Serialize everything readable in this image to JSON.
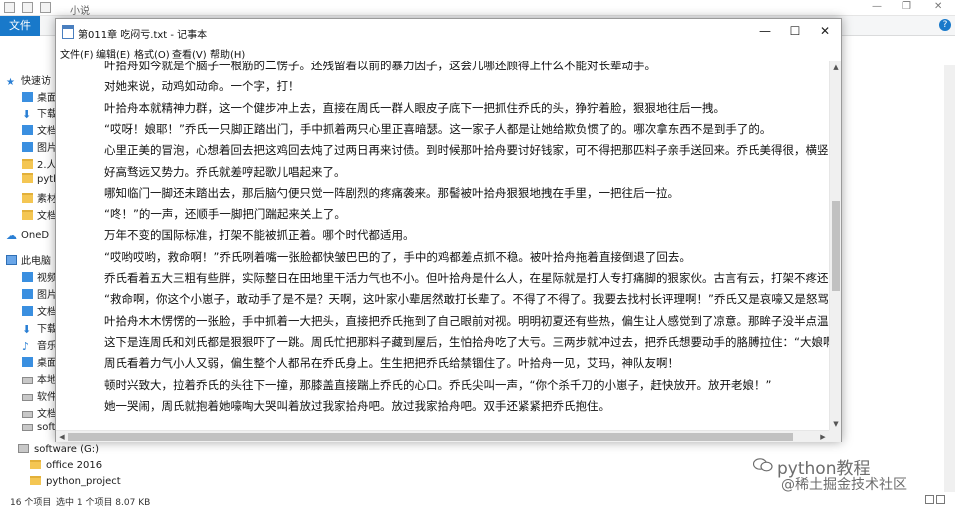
{
  "explorer": {
    "title": "小说",
    "file_tab": "文件",
    "status_items": "16 个项目",
    "status_selection": "选中 1 个项目 8.07 KB",
    "nav_items": [
      {
        "label": "快速访",
        "icon": "star-icon",
        "indent": 0
      },
      {
        "label": "桌面",
        "icon": "desktop-icon",
        "indent": 1
      },
      {
        "label": "下载",
        "icon": "download-icon",
        "indent": 1
      },
      {
        "label": "文档",
        "icon": "document-icon",
        "indent": 1
      },
      {
        "label": "图片",
        "icon": "picture-icon",
        "indent": 1
      },
      {
        "label": "2.人",
        "icon": "folder-icon",
        "indent": 1
      },
      {
        "label": "pyth",
        "icon": "folder-icon",
        "indent": 1
      },
      {
        "label": "素材",
        "icon": "folder-icon",
        "indent": 1
      },
      {
        "label": "文档",
        "icon": "folder-icon",
        "indent": 1
      },
      {
        "label": "OneD",
        "icon": "cloud-icon",
        "indent": 0
      },
      {
        "label": "此电脑",
        "icon": "computer-icon",
        "indent": 0
      },
      {
        "label": "视频",
        "icon": "video-icon",
        "indent": 1
      },
      {
        "label": "图片",
        "icon": "picture-icon",
        "indent": 1
      },
      {
        "label": "文档",
        "icon": "document-icon",
        "indent": 1
      },
      {
        "label": "下载",
        "icon": "download-icon",
        "indent": 1
      },
      {
        "label": "音乐",
        "icon": "music-icon",
        "indent": 1
      },
      {
        "label": "桌面",
        "icon": "desktop-icon",
        "indent": 1
      },
      {
        "label": "本地",
        "icon": "drive-icon",
        "indent": 1
      },
      {
        "label": "软件",
        "icon": "drive-icon",
        "indent": 1
      },
      {
        "label": "文档",
        "icon": "drive-icon",
        "indent": 1
      },
      {
        "label": "soft",
        "icon": "drive-icon",
        "indent": 1
      }
    ],
    "lower_items": [
      {
        "label": "software (G:)",
        "icon": "drive-icon"
      },
      {
        "label": "office 2016",
        "icon": "folder-icon"
      },
      {
        "label": "python_project",
        "icon": "folder-icon"
      }
    ]
  },
  "notepad": {
    "title": "第011章 吃闷亏.txt - 记事本",
    "menus": [
      "文件(F)",
      "编辑(E)",
      "格式(O)",
      "查看(V)",
      "帮助(H)"
    ],
    "lines": [
      "叶拾舟如今就是个脑子一根筋的二愣子。还残留着以前的暴力因子，这会儿哪还顾得上什么不能对长辈动手。",
      "对她来说，动鸡如动命。一个字，打！",
      "叶拾舟本就精神力群，这一个健步冲上去，直接在周氏一群人眼皮子底下一把抓住乔氏的头，狰狞着脸，狠狠地往后一拽。",
      "“哎呀！娘耶！”乔氏一只脚正踏出门，手中抓着两只心里正喜暗瑟。这一家子人都是让她给欺负惯了的。哪次拿东西不是到手了的。",
      "心里正美的冒泡，心想着回去把这鸡回去炖了过两日再来讨债。到时候那叶拾舟要讨好钱家，可不得把那匹料子亲手送回来。乔氏美得很，横竖叶拾",
      "好高骛远又势力。乔氏就差哼起歌儿唱起来了。",
      "哪知临门一脚还未踏出去，那后脑勺便只觉一阵剧烈的疼痛袭来。那髻被叶拾舟狠狠地拽在手里，一把往后一拉。",
      "“咚！”的一声，还顺手一脚把门踹起来关上了。",
      "万年不变的国际标准，打架不能被抓正着。哪个时代都适用。",
      "“哎哟哎哟，救命啊！”乔氏咧着嘴一张脸都快皱巴巴的了，手中的鸡都差点抓不稳。被叶拾舟拖着直接倒退了回去。",
      "乔氏看着五大三粗有些胖，实际整日在田地里干活力气也不小。但叶拾舟是什么人，在星际就是打人专打痛脚的狠家伙。古言有云，打架不疼还打个",
      "“救命啊，你这个小崽子，敢动手了是不是？天啊，这叶家小辈居然敢打长辈了。不得了不得了。我要去找村长评理啊！”乔氏又是哀嚎又是怒骂，",
      "叶拾舟木木愣愣的一张脸，手中抓着一大把头，直接把乔氏拖到了自己眼前对视。明明初夏还有些热，偏生让人感觉到了凉意。那眸子没半点温度，",
      "这下是连周氏和刘氏都是狠狠吓了一跳。周氏忙把那料子藏到屋后，生怕拾舟吃了大亏。三两步就冲过去，把乔氏想要动手的胳膊拉住：“大娘啊，",
      "周氏看着力气小人又弱，偏生整个人都吊在乔氏身上。生生把把乔氏给禁锢住了。叶拾舟一见，艾玛，神队友啊！",
      "顿时兴致大，拉着乔氏的头往下一撞，那膝盖直接踹上乔氏的心口。乔氏尖叫一声，“你个杀千刀的小崽子，赶快放开。放开老娘！”",
      "她一哭闹，周氏就抱着她嚎啕大哭叫着放过我家拾舟吧。放过我家拾舟吧。双手还紧紧把乔氏抱住。"
    ]
  },
  "watermark": {
    "line1": "python教程",
    "line2": "@稀土掘金技术社区"
  }
}
